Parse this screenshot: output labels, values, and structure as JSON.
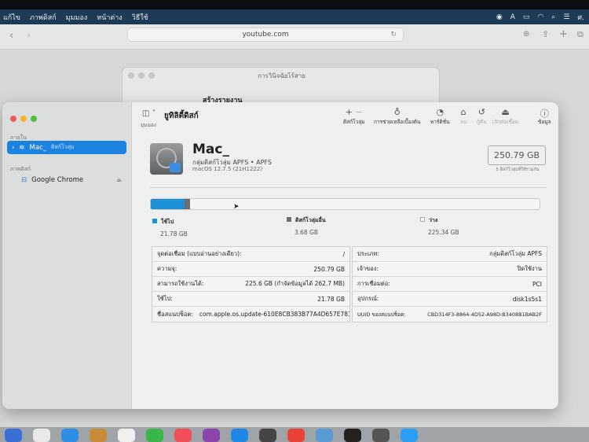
{
  "menubar": {
    "items": [
      "แก้ไข",
      "ภาพดิสก์",
      "มุมมอง",
      "หน้าต่าง",
      "วิธีใช้"
    ],
    "clock": "ศ."
  },
  "safari": {
    "url": "youtube.com"
  },
  "background_window": {
    "title": "การวินิจฉัยไร้สาย",
    "heading": "สร้างรายงาน"
  },
  "disk_utility": {
    "title": "ยูทิลิตี้ดิสก์",
    "view_label": "มุมมอง",
    "sidebar": {
      "section_internal": "ภายใน",
      "selected": {
        "name": "Mac_",
        "sub": "ดิสก์โวลุ่ม"
      },
      "section_images": "ภาพดิสก์",
      "image_item": "Google Chrome"
    },
    "toolbar": [
      {
        "icon": "plus-minus-icon",
        "label": "ดิสก์โวลุ่ม",
        "enabled": true
      },
      {
        "icon": "stethoscope-icon",
        "label": "การช่วยเหลือเบื้องต้น",
        "enabled": true
      },
      {
        "icon": "partition-icon",
        "label": "พาร์ติชั่น",
        "enabled": true
      },
      {
        "icon": "erase-icon",
        "label": "ลบ",
        "enabled": false
      },
      {
        "icon": "restore-icon",
        "label": "กู้คืน",
        "enabled": false
      },
      {
        "icon": "eject-icon",
        "label": "เลิกต่อเชื่อม",
        "enabled": false
      },
      {
        "icon": "info-icon",
        "label": "ข้อมูล",
        "enabled": true
      }
    ],
    "volume": {
      "name": "Mac_",
      "type": "กลุ่มดิสก์โวลุ่ม APFS • APFS",
      "os": "macOS 12.7.5 (21H1222)",
      "size": "250.79 GB",
      "shared": "5 ดิสก์โวลุ่มที่ใช้ร่วมกัน"
    },
    "usage": {
      "capacity_gb": 250.79,
      "segments": [
        {
          "label": "ใช้ไป",
          "value": "21.78 GB",
          "gb": 21.78,
          "color": "#1e90d6"
        },
        {
          "label": "ดิสก์โวลุ่มอื่น",
          "value": "3.68 GB",
          "gb": 3.68,
          "color": "#6e6e6e"
        },
        {
          "label": "ว่าง",
          "value": "225.34 GB",
          "gb": 225.34,
          "color": "#f4f4f4"
        }
      ]
    },
    "info_left": [
      {
        "k": "จุดต่อเชื่อม (แบบอ่านอย่างเดียว):",
        "v": "/"
      },
      {
        "k": "ความจุ:",
        "v": "250.79 GB"
      },
      {
        "k": "สามารถใช้งานได้:",
        "v": "225.6 GB (กำจัดข้อมูลได้ 262.7 MB)"
      },
      {
        "k": "ใช้ไป:",
        "v": "21.78 GB"
      },
      {
        "k": "ชื่อสแนปช็อต:",
        "v": "com.apple.os.update-610E8CB383B77A4D657E7819E2..."
      }
    ],
    "info_right": [
      {
        "k": "ประเภท:",
        "v": "กลุ่มดิสก์โวลุ่ม APFS"
      },
      {
        "k": "เจ้าของ:",
        "v": "ปิดใช้งาน"
      },
      {
        "k": "การเชื่อมต่อ:",
        "v": "PCI"
      },
      {
        "k": "อุปกรณ์:",
        "v": "disk1s5s1"
      },
      {
        "k": "UUID ของสแนปช็อต:",
        "v": "CBD314F3-8864-4D52-A98D-B3408B1BAB2F"
      }
    ]
  }
}
